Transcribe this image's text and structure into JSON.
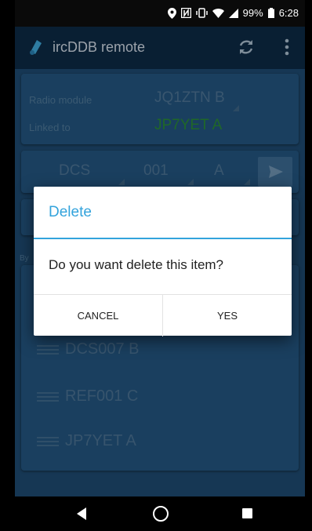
{
  "status_bar": {
    "battery": "99%",
    "time": "6:28"
  },
  "app_bar": {
    "title": "ircDDB remote",
    "icons": [
      "app-logo-icon",
      "refresh-icon",
      "more-vert-icon"
    ]
  },
  "radio_card": {
    "radio_module_label": "Radio module",
    "radio_module_value": "JQ1ZTN B",
    "linked_to_label": "Linked to",
    "linked_to_value": "JP7YET A",
    "linked_color": "#2fbf3a"
  },
  "link_row": {
    "protocol": "DCS",
    "number": "001",
    "module": "A"
  },
  "list_partial_label": "By",
  "list": [
    {
      "label": "DCS007 B"
    },
    {
      "label": "REF001 C"
    },
    {
      "label": "JP7YET A"
    }
  ],
  "dialog": {
    "title": "Delete",
    "message": "Do you want delete this item?",
    "cancel_label": "CANCEL",
    "yes_label": "YES"
  },
  "colors": {
    "accent": "#33a3dc",
    "background": "#1e4a70"
  }
}
